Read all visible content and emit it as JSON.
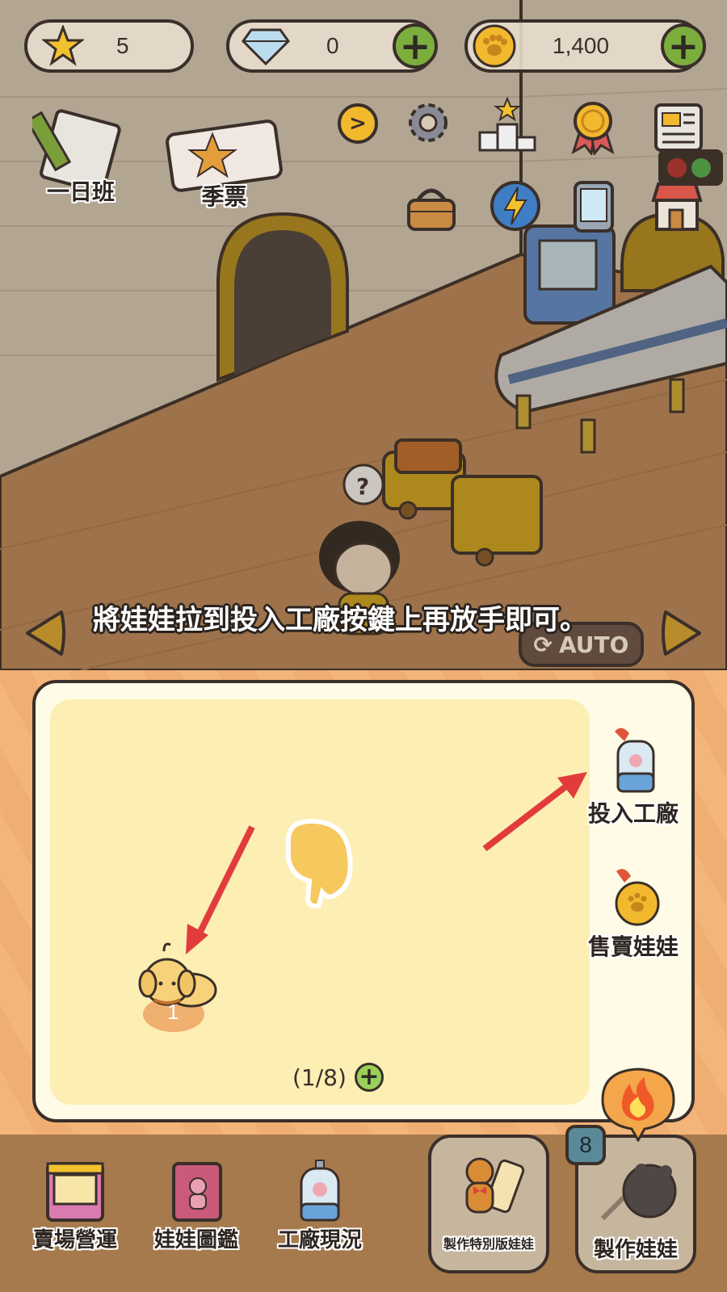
{
  "currencies": {
    "stars": {
      "icon": "star-icon",
      "value": "5"
    },
    "diamonds": {
      "icon": "diamond-icon",
      "value": "0"
    },
    "coins": {
      "icon": "paw-coin-icon",
      "value": "1,400"
    }
  },
  "top_menu": {
    "day_class_label": "一日班",
    "season_ticket_label": "季票"
  },
  "instruction": "將娃娃拉到投入工廠按鍵上再放手即可。",
  "auto_label": "AUTO",
  "panel": {
    "doll_count": "1",
    "capacity": "(1/8)",
    "put_in_factory_label": "投入工廠",
    "sell_doll_label": "售賣娃娃"
  },
  "bottom_nav": {
    "store_ops": "賣場營運",
    "doll_book": "娃娃圖鑑",
    "factory_status": "工廠現況",
    "special_doll": "製作特別版娃娃",
    "make_doll": "製作娃娃",
    "make_badge": "8"
  },
  "colors": {
    "accent_green": "#7cae3e",
    "panel_bg": "#fdeeb4",
    "outline": "#3a2f2a",
    "arrow_red": "#e23b3b"
  }
}
